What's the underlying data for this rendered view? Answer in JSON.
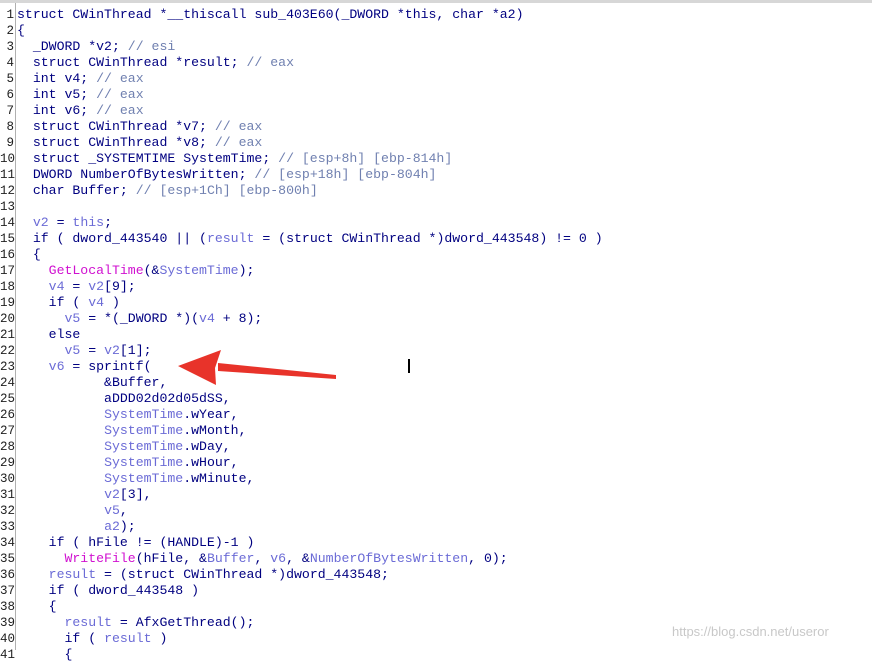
{
  "colors": {
    "default": "#000080",
    "comment": "#7080b0",
    "variable": "#6b6bd6",
    "function": "#d010d0",
    "arrow": "#e8332a"
  },
  "code_lines": [
    {
      "n": "1",
      "tokens": [
        [
          "default",
          "struct CWinThread *__thiscall sub_403E60(_DWORD *this, char *a2)"
        ]
      ]
    },
    {
      "n": "2",
      "tokens": [
        [
          "default",
          "{"
        ]
      ]
    },
    {
      "n": "3",
      "tokens": [
        [
          "default",
          "  _DWORD *v2; "
        ],
        [
          "comment",
          "// esi"
        ]
      ]
    },
    {
      "n": "4",
      "tokens": [
        [
          "default",
          "  struct CWinThread *result; "
        ],
        [
          "comment",
          "// eax"
        ]
      ]
    },
    {
      "n": "5",
      "tokens": [
        [
          "default",
          "  int v4; "
        ],
        [
          "comment",
          "// eax"
        ]
      ]
    },
    {
      "n": "6",
      "tokens": [
        [
          "default",
          "  int v5; "
        ],
        [
          "comment",
          "// eax"
        ]
      ]
    },
    {
      "n": "7",
      "tokens": [
        [
          "default",
          "  int v6; "
        ],
        [
          "comment",
          "// eax"
        ]
      ]
    },
    {
      "n": "8",
      "tokens": [
        [
          "default",
          "  struct CWinThread *v7; "
        ],
        [
          "comment",
          "// eax"
        ]
      ]
    },
    {
      "n": "9",
      "tokens": [
        [
          "default",
          "  struct CWinThread *v8; "
        ],
        [
          "comment",
          "// eax"
        ]
      ]
    },
    {
      "n": "10",
      "tokens": [
        [
          "default",
          "  struct _SYSTEMTIME SystemTime; "
        ],
        [
          "comment",
          "// [esp+8h] [ebp-814h]"
        ]
      ]
    },
    {
      "n": "11",
      "tokens": [
        [
          "default",
          "  DWORD NumberOfBytesWritten; "
        ],
        [
          "comment",
          "// [esp+18h] [ebp-804h]"
        ]
      ]
    },
    {
      "n": "12",
      "tokens": [
        [
          "default",
          "  char Buffer; "
        ],
        [
          "comment",
          "// [esp+1Ch] [ebp-800h]"
        ]
      ]
    },
    {
      "n": "13",
      "tokens": [
        [
          "default",
          ""
        ]
      ]
    },
    {
      "n": "14",
      "tokens": [
        [
          "default",
          "  "
        ],
        [
          "var",
          "v2"
        ],
        [
          "default",
          " = "
        ],
        [
          "var",
          "this"
        ],
        [
          "default",
          ";"
        ]
      ]
    },
    {
      "n": "15",
      "tokens": [
        [
          "default",
          "  if ( dword_443540 || ("
        ],
        [
          "var",
          "result"
        ],
        [
          "default",
          " = (struct CWinThread *)dword_443548) != 0 )"
        ]
      ]
    },
    {
      "n": "16",
      "tokens": [
        [
          "default",
          "  {"
        ]
      ]
    },
    {
      "n": "17",
      "tokens": [
        [
          "default",
          "    "
        ],
        [
          "func",
          "GetLocalTime"
        ],
        [
          "default",
          "(&"
        ],
        [
          "var",
          "SystemTime"
        ],
        [
          "default",
          ");"
        ]
      ]
    },
    {
      "n": "18",
      "tokens": [
        [
          "default",
          "    "
        ],
        [
          "var",
          "v4"
        ],
        [
          "default",
          " = "
        ],
        [
          "var",
          "v2"
        ],
        [
          "default",
          "[9];"
        ]
      ]
    },
    {
      "n": "19",
      "tokens": [
        [
          "default",
          "    if ( "
        ],
        [
          "var",
          "v4"
        ],
        [
          "default",
          " )"
        ]
      ]
    },
    {
      "n": "20",
      "tokens": [
        [
          "default",
          "      "
        ],
        [
          "var",
          "v5"
        ],
        [
          "default",
          " = *(_DWORD *)("
        ],
        [
          "var",
          "v4"
        ],
        [
          "default",
          " + 8);"
        ]
      ]
    },
    {
      "n": "21",
      "tokens": [
        [
          "default",
          "    else"
        ]
      ]
    },
    {
      "n": "22",
      "tokens": [
        [
          "default",
          "      "
        ],
        [
          "var",
          "v5"
        ],
        [
          "default",
          " = "
        ],
        [
          "var",
          "v2"
        ],
        [
          "default",
          "[1];"
        ]
      ]
    },
    {
      "n": "23",
      "tokens": [
        [
          "default",
          "    "
        ],
        [
          "var",
          "v6"
        ],
        [
          "default",
          " = sprintf("
        ]
      ]
    },
    {
      "n": "24",
      "tokens": [
        [
          "default",
          "           &Buffer,"
        ]
      ]
    },
    {
      "n": "25",
      "tokens": [
        [
          "default",
          "           aDDD02d02d05dSS,"
        ]
      ]
    },
    {
      "n": "26",
      "tokens": [
        [
          "default",
          "           "
        ],
        [
          "var",
          "SystemTime"
        ],
        [
          "default",
          ".wYear,"
        ]
      ]
    },
    {
      "n": "27",
      "tokens": [
        [
          "default",
          "           "
        ],
        [
          "var",
          "SystemTime"
        ],
        [
          "default",
          ".wMonth,"
        ]
      ]
    },
    {
      "n": "28",
      "tokens": [
        [
          "default",
          "           "
        ],
        [
          "var",
          "SystemTime"
        ],
        [
          "default",
          ".wDay,"
        ]
      ]
    },
    {
      "n": "29",
      "tokens": [
        [
          "default",
          "           "
        ],
        [
          "var",
          "SystemTime"
        ],
        [
          "default",
          ".wHour,"
        ]
      ]
    },
    {
      "n": "30",
      "tokens": [
        [
          "default",
          "           "
        ],
        [
          "var",
          "SystemTime"
        ],
        [
          "default",
          ".wMinute,"
        ]
      ]
    },
    {
      "n": "31",
      "tokens": [
        [
          "default",
          "           "
        ],
        [
          "var",
          "v2"
        ],
        [
          "default",
          "[3],"
        ]
      ]
    },
    {
      "n": "32",
      "tokens": [
        [
          "default",
          "           "
        ],
        [
          "var",
          "v5"
        ],
        [
          "default",
          ","
        ]
      ]
    },
    {
      "n": "33",
      "tokens": [
        [
          "default",
          "           "
        ],
        [
          "var",
          "a2"
        ],
        [
          "default",
          ");"
        ]
      ]
    },
    {
      "n": "34",
      "tokens": [
        [
          "default",
          "    if ( hFile != (HANDLE)-1 )"
        ]
      ]
    },
    {
      "n": "35",
      "tokens": [
        [
          "default",
          "      "
        ],
        [
          "func",
          "WriteFile"
        ],
        [
          "default",
          "(hFile, &"
        ],
        [
          "var",
          "Buffer"
        ],
        [
          "default",
          ", "
        ],
        [
          "var",
          "v6"
        ],
        [
          "default",
          ", &"
        ],
        [
          "var",
          "NumberOfBytesWritten"
        ],
        [
          "default",
          ", 0);"
        ]
      ]
    },
    {
      "n": "36",
      "tokens": [
        [
          "default",
          "    "
        ],
        [
          "var",
          "result"
        ],
        [
          "default",
          " = (struct CWinThread *)dword_443548;"
        ]
      ]
    },
    {
      "n": "37",
      "tokens": [
        [
          "default",
          "    if ( dword_443548 )"
        ]
      ]
    },
    {
      "n": "38",
      "tokens": [
        [
          "default",
          "    {"
        ]
      ]
    },
    {
      "n": "39",
      "tokens": [
        [
          "default",
          "      "
        ],
        [
          "var",
          "result"
        ],
        [
          "default",
          " = AfxGetThread();"
        ]
      ]
    },
    {
      "n": "40",
      "tokens": [
        [
          "default",
          "      if ( "
        ],
        [
          "var",
          "result"
        ],
        [
          "default",
          " )"
        ]
      ]
    },
    {
      "n": "41",
      "tokens": [
        [
          "default",
          "      {"
        ]
      ]
    }
  ],
  "watermark": "https://blog.csdn.net/useror"
}
